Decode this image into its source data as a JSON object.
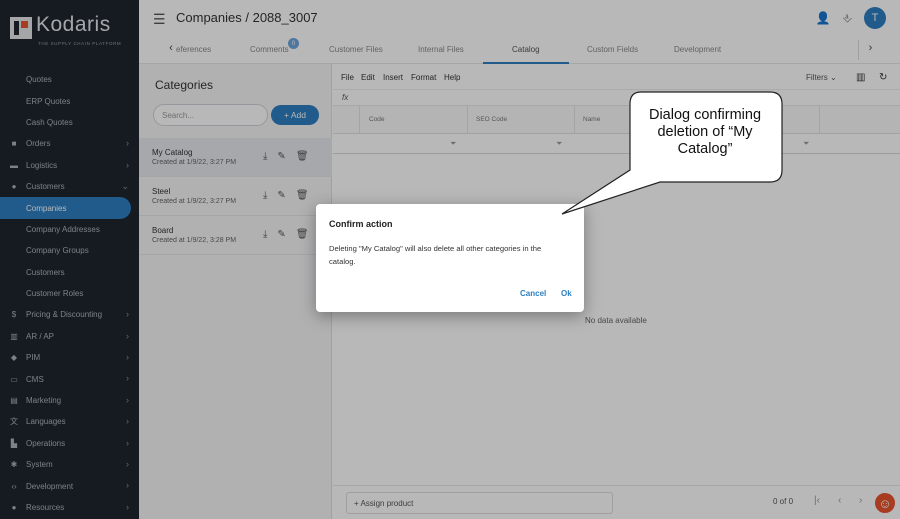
{
  "brand": {
    "name": "Kodaris",
    "tagline": "THE SUPPLY CHAIN PLATFORM"
  },
  "header": {
    "title": "Companies / 2088_3007",
    "avatar_initial": "T"
  },
  "tabs": [
    {
      "label": "eferences"
    },
    {
      "label": "Comments",
      "badge": "0"
    },
    {
      "label": "Customer Files"
    },
    {
      "label": "Internal Files"
    },
    {
      "label": "Catalog",
      "active": true
    },
    {
      "label": "Custom Fields"
    },
    {
      "label": "Development"
    }
  ],
  "sidebar": {
    "items": [
      {
        "label": "Quotes"
      },
      {
        "label": "ERP Quotes"
      },
      {
        "label": "Cash Quotes"
      },
      {
        "label": "Orders"
      },
      {
        "label": "Logistics"
      },
      {
        "label": "Customers"
      },
      {
        "label": "Companies"
      },
      {
        "label": "Company Addresses"
      },
      {
        "label": "Company Groups"
      },
      {
        "label": "Customers"
      },
      {
        "label": "Customer Roles"
      },
      {
        "label": "Pricing & Discounting"
      },
      {
        "label": "AR / AP"
      },
      {
        "label": "PIM"
      },
      {
        "label": "CMS"
      },
      {
        "label": "Marketing"
      },
      {
        "label": "Languages"
      },
      {
        "label": "Operations"
      },
      {
        "label": "System"
      },
      {
        "label": "Development"
      },
      {
        "label": "Resources"
      }
    ]
  },
  "categories": {
    "title": "Categories",
    "search_placeholder": "Search...",
    "add_label": "+ Add",
    "items": [
      {
        "name": "My Catalog",
        "created": "Created at 1/9/22, 3:27 PM"
      },
      {
        "name": "Steel",
        "created": "Created at 1/9/22, 3:27 PM"
      },
      {
        "name": "Board",
        "created": "Created at 1/9/22, 3:28 PM"
      }
    ]
  },
  "grid": {
    "menu": [
      "File",
      "Edit",
      "Insert",
      "Format",
      "Help"
    ],
    "filters_label": "Filters",
    "fx_label": "fx",
    "columns": [
      "Code",
      "SEO Code",
      "Name"
    ],
    "no_data": "No data available",
    "assign_label": "+ Assign product",
    "pager": "0 of 0"
  },
  "dialog": {
    "title": "Confirm action",
    "body": "Deleting \"My Catalog\" will also delete all other categories in the catalog.",
    "cancel": "Cancel",
    "ok": "Ok"
  },
  "callout": {
    "line1": "Dialog confirming",
    "line2": "deletion of “My",
    "line3": "Catalog”"
  },
  "colors": {
    "accent": "#2d7fc1",
    "sidebar": "#1f2630",
    "brand_orange": "#e8542f"
  }
}
